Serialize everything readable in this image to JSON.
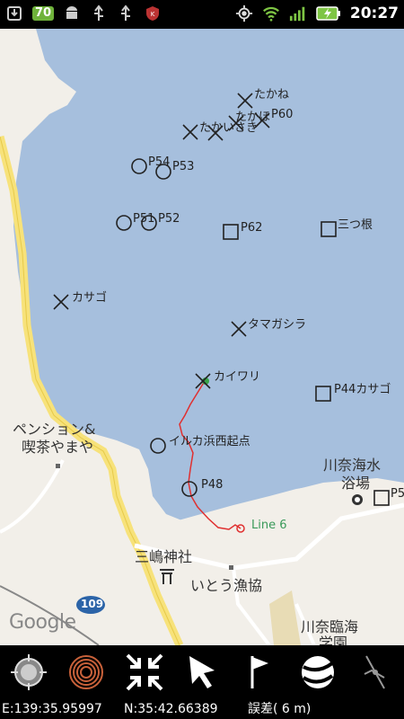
{
  "status_bar": {
    "battery_level": "70",
    "time": "20:27",
    "icons_left": [
      "download-icon",
      "battery-badge",
      "android-icon",
      "usb-icon",
      "usb-icon",
      "antivirus-icon"
    ],
    "icons_right": [
      "gps-icon",
      "wifi-icon",
      "signal-icon",
      "battery-charging-icon"
    ]
  },
  "map": {
    "waypoints": [
      {
        "label": "たかね",
        "symbol": "x"
      },
      {
        "label": "たかほ",
        "symbol": "x"
      },
      {
        "label": "P60",
        "symbol": "x"
      },
      {
        "label": "たかいさき",
        "symbol": "x"
      },
      {
        "label": "P54",
        "symbol": "circle"
      },
      {
        "label": "P53",
        "symbol": "circle"
      },
      {
        "label": "P51",
        "symbol": "circle"
      },
      {
        "label": "P52",
        "symbol": "circle"
      },
      {
        "label": "P62",
        "symbol": "square"
      },
      {
        "label": "三つ根",
        "symbol": "square"
      },
      {
        "label": "カサゴ",
        "symbol": "x"
      },
      {
        "label": "タマガシラ",
        "symbol": "x"
      },
      {
        "label": "カイワリ",
        "symbol": "x"
      },
      {
        "label": "P44カサゴ",
        "symbol": "square"
      },
      {
        "label": "イルカ浜西起点",
        "symbol": "circle"
      },
      {
        "label": "P48",
        "symbol": "circle"
      },
      {
        "label": "P5",
        "symbol": "square"
      }
    ],
    "route_label": "Line 6",
    "places": {
      "pension": "ペンション&",
      "cafe": "喫茶やまや",
      "beach_1": "川奈海水",
      "beach_2": "浴場",
      "shrine": "三嶋神社",
      "fish_market": "いとう漁協",
      "school_1": "川奈臨海",
      "school_2": "学園",
      "road_number": "109"
    },
    "attribution": "Google",
    "colors": {
      "sea": "#a6bfdd",
      "land": "#f2efe9",
      "road": "#ffffff",
      "highway": "#f7e27a",
      "route": "#e03030"
    }
  },
  "toolbar": {
    "buttons": [
      {
        "name": "locate-button",
        "icon": "crosshair-icon"
      },
      {
        "name": "track-button",
        "icon": "rings-icon"
      },
      {
        "name": "fullscreen-button",
        "icon": "arrows-in-icon"
      },
      {
        "name": "navigate-button",
        "icon": "cursor-arrow-icon"
      },
      {
        "name": "waypoint-button",
        "icon": "flag-icon"
      },
      {
        "name": "layers-button",
        "icon": "globe-icon"
      },
      {
        "name": "compass-button",
        "icon": "compass-icon"
      }
    ]
  },
  "coordinates": {
    "easting": "E:139:35.95997",
    "northing": "N:35:42.66389",
    "accuracy": "誤差( 6 m)"
  }
}
